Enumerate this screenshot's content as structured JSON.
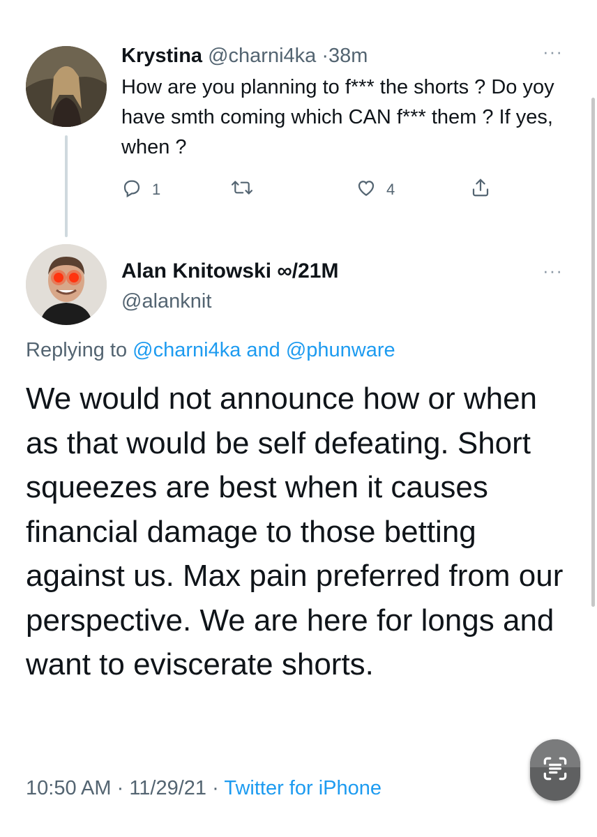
{
  "reply_tweet": {
    "name": "Krystina",
    "handle": "@charni4ka",
    "separator": "·",
    "time": "38m",
    "more": "···",
    "text": "How are you planning to f*** the shorts ? Do yoy have smth coming which CAN f*** them ? If yes, when ?",
    "reply_count": "1",
    "retweet_count": "",
    "like_count": "4"
  },
  "main_tweet": {
    "name": "Alan Knitowski ∞/21M",
    "handle": "@alanknit",
    "more": "···",
    "replying_prefix": "Replying to",
    "replying_user1": "@charni4ka",
    "replying_and": "and",
    "replying_user2": "@phunware",
    "text": "We would not announce how or when as that would be self defeating. Short squeezes are best when it causes financial damage to those betting against us. Max pain preferred from our perspective. We are here for longs and want to eviscerate shorts.",
    "time": "10:50 AM",
    "date": "11/29/21",
    "separator": "·",
    "source": "Twitter for iPhone"
  },
  "colors": {
    "text": "#0f1419",
    "secondary": "#536471",
    "link": "#1d9bf0",
    "thread_line": "#cfd9de"
  },
  "icons": {
    "reply": "reply-icon",
    "retweet": "retweet-icon",
    "like": "heart-icon",
    "share": "share-icon",
    "scan": "scan-text-icon"
  }
}
